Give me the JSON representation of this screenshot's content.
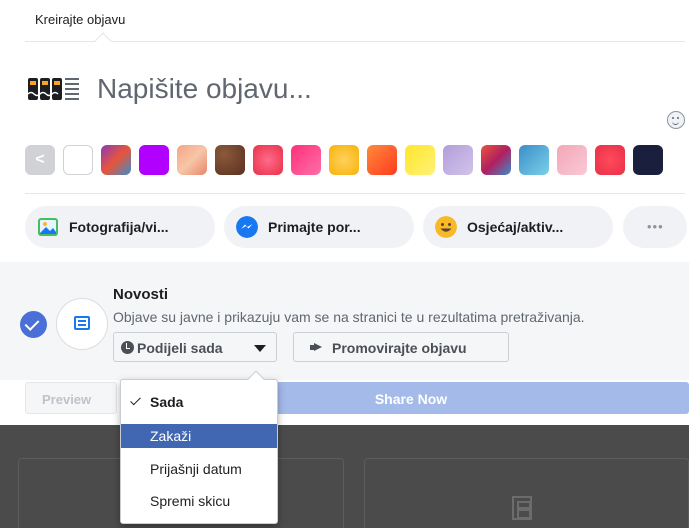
{
  "composer": {
    "header_tab": "Kreirajte objavu",
    "placeholder": "Napišite objavu..."
  },
  "backgrounds": {
    "prev_glyph": "<",
    "swatches": [
      "#ffffff",
      "#8a3ab9",
      "#b200ff",
      "#f4a582",
      "#6b3a2a",
      "#e8304a",
      "#ff2f7a",
      "#f6b20b",
      "#ff5a1f",
      "#ffe62b",
      "#b39ddb",
      "#e8543a",
      "#3b8ec9",
      "#f5a6b8",
      "#e8304a",
      "#1a1f3d"
    ]
  },
  "actions": {
    "photo_label": "Fotografija/vi...",
    "messenger_label": "Primajte por...",
    "feeling_label": "Osjećaj/aktiv...",
    "more_label": "•••"
  },
  "placement": {
    "title": "Novosti",
    "description": "Objave su javne i prikazuju vam se na stranici te u rezultatima pretraživanja.",
    "share_dropdown_label": "Podijeli sada",
    "promote_label": "Promovirajte objavu"
  },
  "buttons": {
    "preview": "Preview",
    "share_now": "Share Now"
  },
  "menu": {
    "items": [
      {
        "label": "Sada",
        "selected": true
      },
      {
        "label": "Zakaži",
        "highlighted": true
      },
      {
        "label": "Prijašnji datum"
      },
      {
        "label": "Spremi skicu"
      }
    ]
  },
  "colors": {
    "accent": "#4267b2",
    "share_now_bg": "#a4bae9",
    "check": "#4a6fd8"
  }
}
